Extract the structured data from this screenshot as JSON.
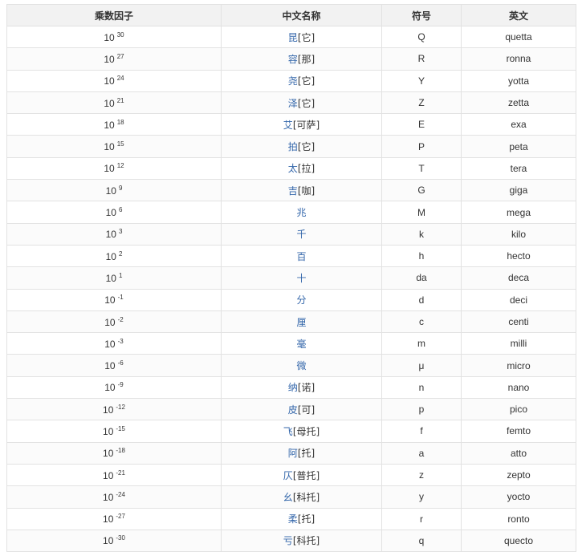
{
  "headers": [
    "乘数因子",
    "中文名称",
    "符号",
    "英文"
  ],
  "rows": [
    {
      "base": "10",
      "exp": "30",
      "cn": "昆",
      "cn_suffix": "[它]",
      "symbol": "Q",
      "en": "quetta"
    },
    {
      "base": "10",
      "exp": "27",
      "cn": "容",
      "cn_suffix": "[那]",
      "symbol": "R",
      "en": "ronna"
    },
    {
      "base": "10",
      "exp": "24",
      "cn": "尧",
      "cn_suffix": "[它]",
      "symbol": "Y",
      "en": "yotta"
    },
    {
      "base": "10",
      "exp": "21",
      "cn": "泽",
      "cn_suffix": "[它]",
      "symbol": "Z",
      "en": "zetta"
    },
    {
      "base": "10",
      "exp": "18",
      "cn": "艾",
      "cn_suffix": "[可萨]",
      "symbol": "E",
      "en": "exa"
    },
    {
      "base": "10",
      "exp": "15",
      "cn": "拍",
      "cn_suffix": "[它]",
      "symbol": "P",
      "en": "peta"
    },
    {
      "base": "10",
      "exp": "12",
      "cn": "太",
      "cn_suffix": "[拉]",
      "symbol": "T",
      "en": "tera"
    },
    {
      "base": "10",
      "exp": "9",
      "cn": "吉",
      "cn_suffix": "[咖]",
      "symbol": "G",
      "en": "giga"
    },
    {
      "base": "10",
      "exp": "6",
      "cn": "兆",
      "cn_suffix": "",
      "symbol": "M",
      "en": "mega"
    },
    {
      "base": "10",
      "exp": "3",
      "cn": "千",
      "cn_suffix": "",
      "symbol": "k",
      "en": "kilo"
    },
    {
      "base": "10",
      "exp": "2",
      "cn": "百",
      "cn_suffix": "",
      "symbol": "h",
      "en": "hecto"
    },
    {
      "base": "10",
      "exp": "1",
      "cn": "十",
      "cn_suffix": "",
      "symbol": "da",
      "en": "deca"
    },
    {
      "base": "10",
      "exp": "-1",
      "cn": "分",
      "cn_suffix": "",
      "symbol": "d",
      "en": "deci"
    },
    {
      "base": "10",
      "exp": "-2",
      "cn": "厘",
      "cn_suffix": "",
      "symbol": "c",
      "en": "centi"
    },
    {
      "base": "10",
      "exp": "-3",
      "cn": "毫",
      "cn_suffix": "",
      "symbol": "m",
      "en": "milli"
    },
    {
      "base": "10",
      "exp": "-6",
      "cn": "微",
      "cn_suffix": "",
      "symbol": "μ",
      "en": "micro"
    },
    {
      "base": "10",
      "exp": "-9",
      "cn": "纳",
      "cn_suffix": "[诺]",
      "symbol": "n",
      "en": "nano"
    },
    {
      "base": "10",
      "exp": "-12",
      "cn": "皮",
      "cn_suffix": "[可]",
      "symbol": "p",
      "en": "pico"
    },
    {
      "base": "10",
      "exp": "-15",
      "cn": "飞",
      "cn_suffix": "[母托]",
      "symbol": "f",
      "en": "femto"
    },
    {
      "base": "10",
      "exp": "-18",
      "cn": "阿",
      "cn_suffix": "[托]",
      "symbol": "a",
      "en": "atto"
    },
    {
      "base": "10",
      "exp": "-21",
      "cn": "仄",
      "cn_suffix": "[普托]",
      "symbol": "z",
      "en": "zepto"
    },
    {
      "base": "10",
      "exp": "-24",
      "cn": "幺",
      "cn_suffix": "[科托]",
      "symbol": "y",
      "en": "yocto"
    },
    {
      "base": "10",
      "exp": "-27",
      "cn": "柔",
      "cn_suffix": "[托]",
      "symbol": "r",
      "en": "ronto"
    },
    {
      "base": "10",
      "exp": "-30",
      "cn": "亏",
      "cn_suffix": "[科托]",
      "symbol": "q",
      "en": "quecto"
    }
  ],
  "colors": {
    "link": "#3366aa",
    "header_bg": "#f2f2f2",
    "border": "#e2e2e2"
  }
}
